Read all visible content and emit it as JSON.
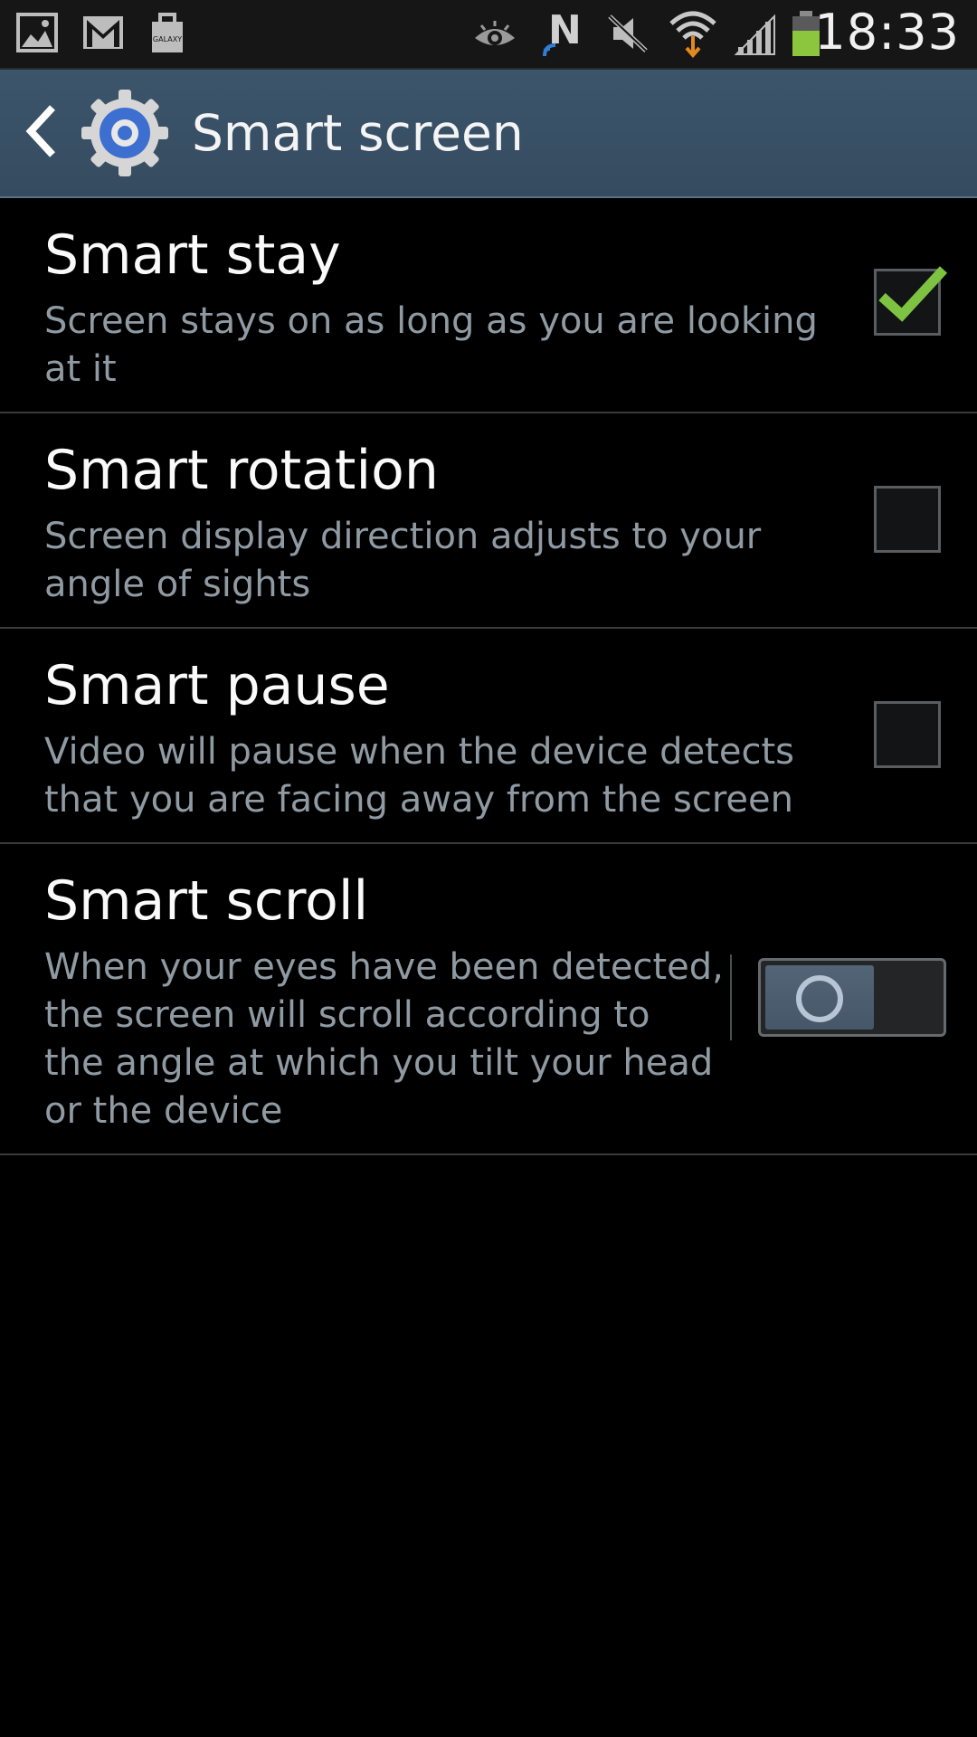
{
  "status_bar": {
    "time": "18:33",
    "icons": [
      "gallery-icon",
      "gmail-icon",
      "galaxy-store-icon",
      "smart-stay-eye-icon",
      "nfc-icon",
      "mute-icon",
      "wifi-icon",
      "signal-icon",
      "battery-icon"
    ],
    "galaxy_label": "GALAXY"
  },
  "action_bar": {
    "title": "Smart screen"
  },
  "settings": [
    {
      "title": "Smart stay",
      "summary_lines": [
        "Screen stays on as long as you are looking",
        "at it"
      ],
      "control": "checkbox",
      "checked": true
    },
    {
      "title": "Smart rotation",
      "summary_lines": [
        "Screen display direction adjusts to your",
        "angle of sights"
      ],
      "control": "checkbox",
      "checked": false
    },
    {
      "title": "Smart pause",
      "summary_lines": [
        "Video will pause when the device detects",
        "that you are facing away from the screen"
      ],
      "control": "checkbox",
      "checked": false
    },
    {
      "title": "Smart scroll",
      "summary_lines": [
        "When your eyes have been detected,",
        "the screen will scroll according to",
        "the angle at which you tilt your head",
        "or the device"
      ],
      "control": "switch",
      "on": false
    }
  ],
  "colors": {
    "action_bar": "#3a5269",
    "check_green": "#7ec242",
    "summary_text": "#8f9aa3"
  }
}
